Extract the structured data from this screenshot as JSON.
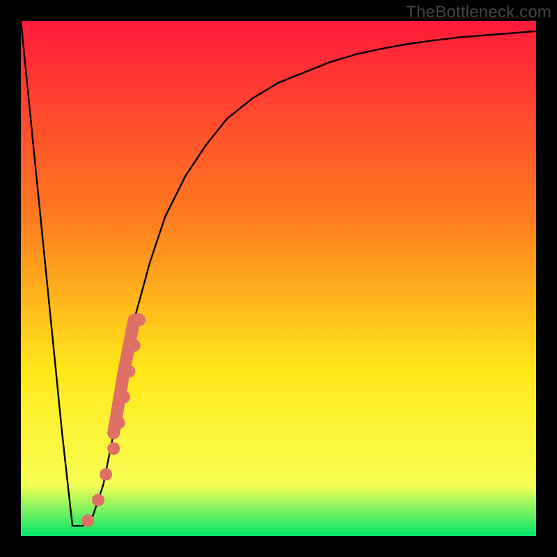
{
  "watermark": "TheBottleneck.com",
  "colors": {
    "frame": "#000000",
    "gradient_top": "#ff1a3a",
    "gradient_mid1": "#ff7b1f",
    "gradient_mid2": "#ffe81a",
    "gradient_mid3": "#f7ff54",
    "gradient_bottom": "#00e66b",
    "curve": "#000000",
    "markers": "#e07066"
  },
  "chart_data": {
    "type": "line",
    "title": "",
    "xlabel": "",
    "ylabel": "",
    "xlim": [
      0,
      100
    ],
    "ylim": [
      0,
      100
    ],
    "series": [
      {
        "name": "bottleneck-curve",
        "x": [
          0,
          4,
          8,
          10,
          12,
          14,
          16,
          18,
          20,
          22,
          25,
          28,
          32,
          36,
          40,
          45,
          50,
          55,
          60,
          65,
          70,
          75,
          80,
          85,
          90,
          95,
          100
        ],
        "y": [
          100,
          60,
          20,
          2,
          2,
          4,
          10,
          20,
          32,
          42,
          53,
          62,
          70,
          76,
          81,
          85,
          88,
          90,
          92,
          93.5,
          94.6,
          95.5,
          96.2,
          96.8,
          97.2,
          97.6,
          98
        ]
      }
    ],
    "markers": {
      "name": "highlight-dots",
      "points": [
        {
          "x": 13.0,
          "y": 3.0
        },
        {
          "x": 15.0,
          "y": 7.0
        },
        {
          "x": 16.5,
          "y": 12.0
        },
        {
          "x": 18.0,
          "y": 17.0
        },
        {
          "x": 19.0,
          "y": 22.0
        },
        {
          "x": 20.0,
          "y": 27.0
        },
        {
          "x": 21.0,
          "y": 32.0
        },
        {
          "x": 22.0,
          "y": 37.0
        },
        {
          "x": 23.0,
          "y": 42.0
        }
      ]
    }
  }
}
